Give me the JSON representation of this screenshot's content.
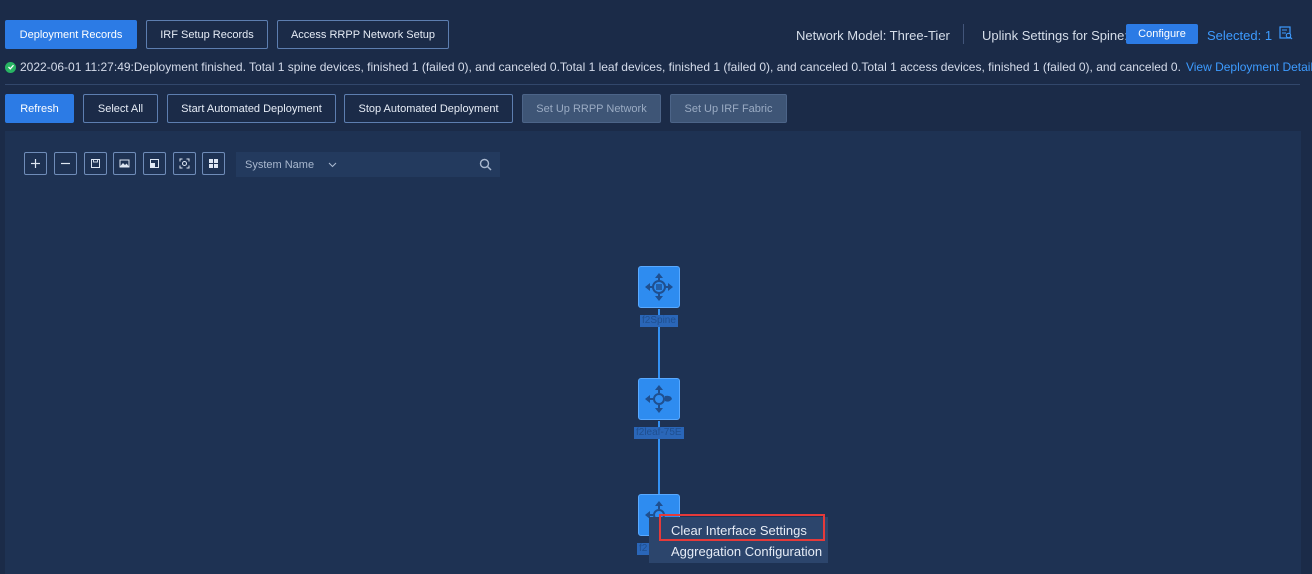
{
  "tabs": {
    "deployment_records": "Deployment Records",
    "irf_setup_records": "IRF Setup Records",
    "access_rrpp": "Access RRPP Network Setup"
  },
  "header": {
    "network_model": "Network Model: Three-Tier",
    "uplink_settings": "Uplink Settings for Spine:",
    "configure": "Configure",
    "selected": "Selected: 1"
  },
  "status": {
    "message": "2022-06-01 11:27:49:Deployment finished. Total 1 spine devices, finished 1 (failed 0), and canceled 0.Total 1 leaf devices, finished 1 (failed 0), and canceled 0.Total 1 access devices, finished 1 (failed 0), and canceled 0.",
    "view_details": "View Deployment Details"
  },
  "toolbar": {
    "refresh": "Refresh",
    "select_all": "Select All",
    "start_deploy": "Start Automated Deployment",
    "stop_deploy": "Stop Automated Deployment",
    "setup_rrpp": "Set Up RRPP Network",
    "setup_irf": "Set Up IRF Fabric"
  },
  "search": {
    "field": "System Name"
  },
  "topology": {
    "nodes": [
      {
        "label": "f2Spine",
        "role": "spine"
      },
      {
        "label": "f2leaf-75E",
        "role": "leaf"
      },
      {
        "label": "f2",
        "role": "access"
      }
    ]
  },
  "context_menu": {
    "items": [
      "Clear Interface Settings",
      "Aggregation Configuration"
    ]
  },
  "colors": {
    "primary": "#2c7be5",
    "link": "#3d9bff",
    "highlight": "#e53a3a",
    "node": "#2e8cf0"
  }
}
